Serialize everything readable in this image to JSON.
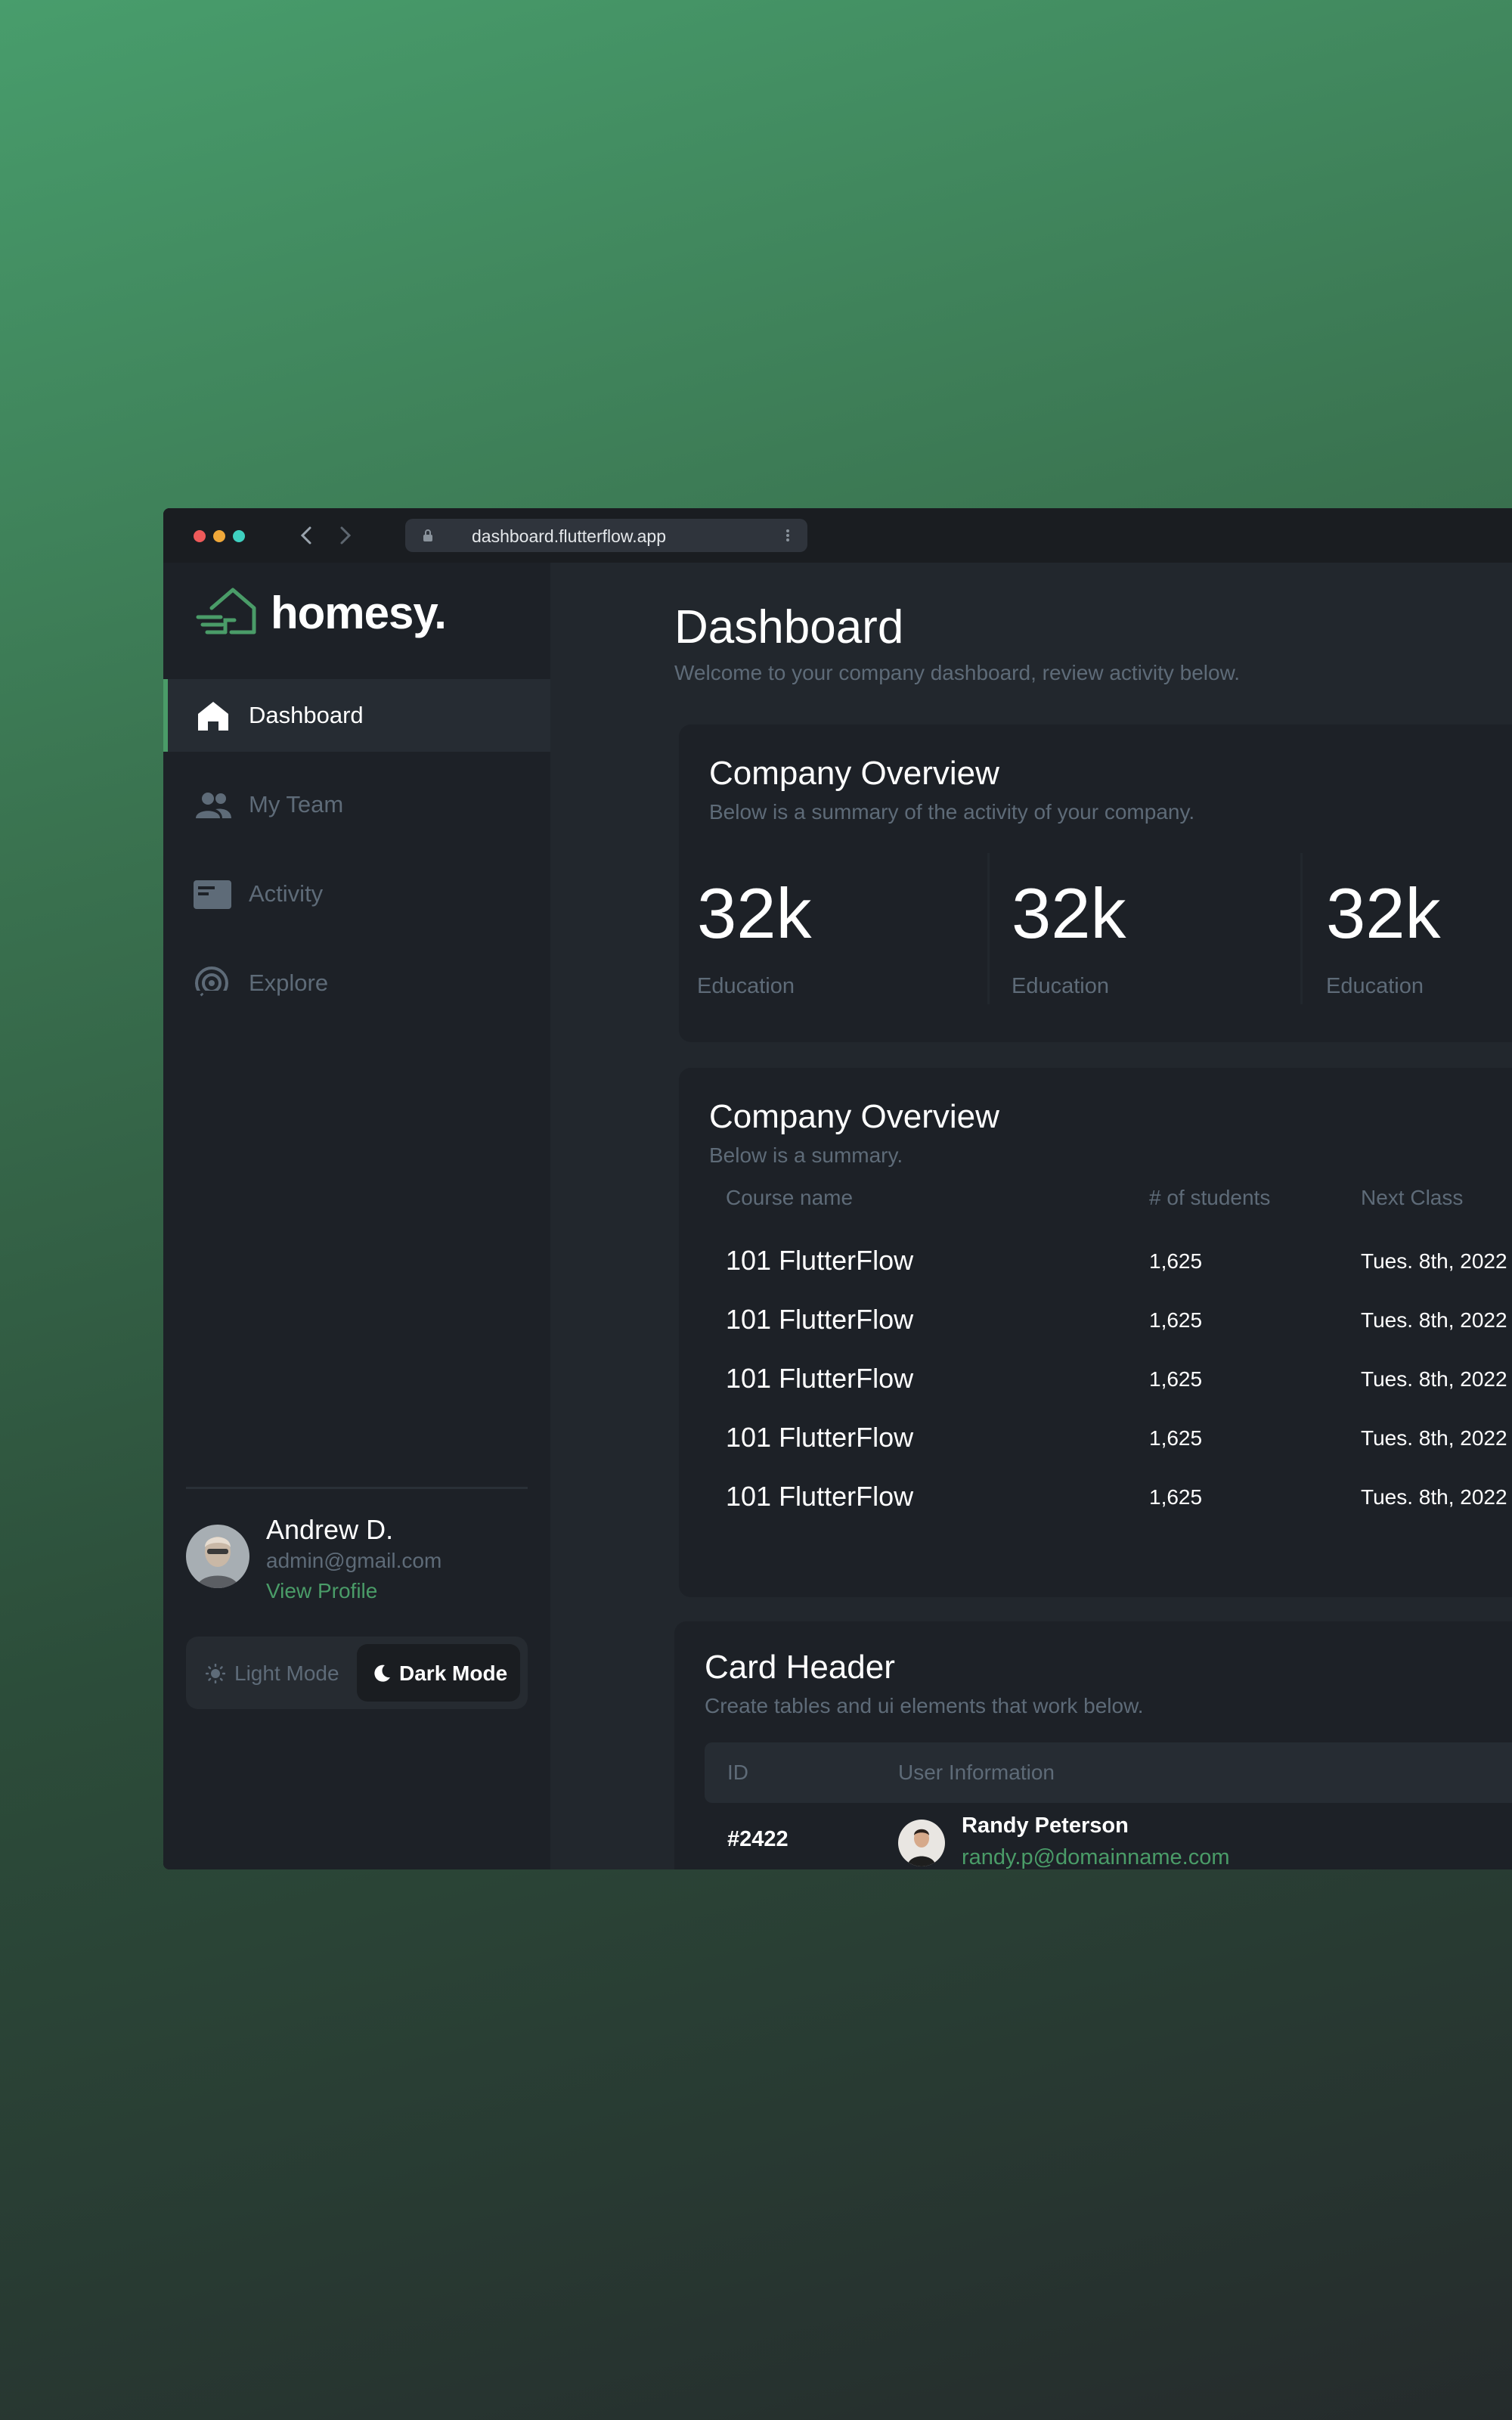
{
  "browser": {
    "url": "dashboard.flutterflow.app",
    "traffic_colors": [
      "#ee5a5a",
      "#f0a83a",
      "#3fd0c0"
    ]
  },
  "sidebar": {
    "brand": "homesy.",
    "items": [
      {
        "label": "Dashboard",
        "icon": "home-icon",
        "active": true
      },
      {
        "label": "My Team",
        "icon": "team-icon",
        "active": false
      },
      {
        "label": "Activity",
        "icon": "activity-icon",
        "active": false
      },
      {
        "label": "Explore",
        "icon": "explore-icon",
        "active": false
      }
    ],
    "mode": {
      "light": "Light Mode",
      "dark": "Dark Mode",
      "selected": "Dark Mode"
    },
    "user": {
      "name": "Andrew D.",
      "email": "admin@gmail.com",
      "link": "View Profile"
    }
  },
  "main": {
    "title": "Dashboard",
    "subtitle": "Welcome to your company dashboard, review activity below.",
    "overview": {
      "title": "Company Overview",
      "subtitle": "Below is a summary of the activity of your company.",
      "stats": [
        {
          "value": "32k",
          "label": "Education"
        },
        {
          "value": "32k",
          "label": "Education"
        },
        {
          "value": "32k",
          "label": "Education"
        }
      ]
    },
    "courses": {
      "title": "Company Overview",
      "subtitle": "Below is a summary.",
      "headers": [
        "Course name",
        "# of students",
        "Next Class"
      ],
      "rows": [
        [
          "101 FlutterFlow",
          "1,625",
          "Tues. 8th, 2022"
        ],
        [
          "101 FlutterFlow",
          "1,625",
          "Tues. 8th, 2022"
        ],
        [
          "101 FlutterFlow",
          "1,625",
          "Tues. 8th, 2022"
        ],
        [
          "101 FlutterFlow",
          "1,625",
          "Tues. 8th, 2022"
        ],
        [
          "101 FlutterFlow",
          "1,625",
          "Tues. 8th, 2022"
        ]
      ]
    },
    "users_card": {
      "title": "Card Header",
      "subtitle": "Create tables and ui elements that work below.",
      "headers": [
        "ID",
        "User Information"
      ],
      "rows": [
        {
          "id": "#2422",
          "name": "Randy Peterson",
          "email": "randy.p@domainname.com"
        }
      ]
    }
  },
  "colors": {
    "accent": "#4a9c68",
    "muted": "#5e6b78",
    "surface": "#1d2127",
    "background": "#22272d"
  }
}
